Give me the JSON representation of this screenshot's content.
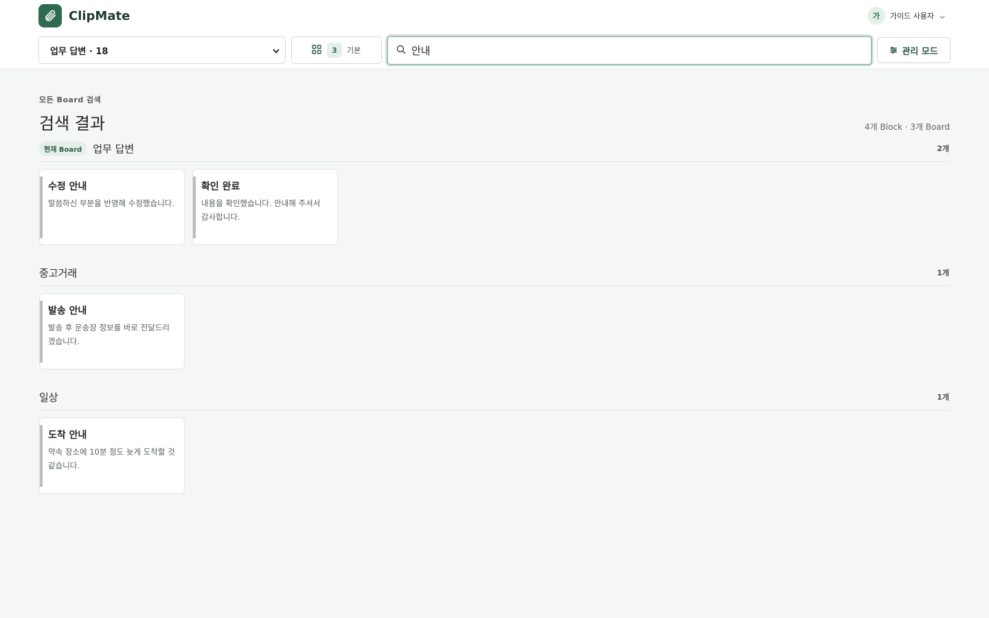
{
  "app": {
    "name": "ClipMate",
    "accent": "#2e6a4f"
  },
  "user": {
    "avatar_initial": "가",
    "name": "가이드 사용자"
  },
  "toolbar": {
    "board_select": {
      "selected": "업무 답변 · 18"
    },
    "view_toggle": {
      "count": "3",
      "label": "기본"
    },
    "search": {
      "value": "안내",
      "placeholder": ""
    },
    "admin_label": "관리 모드"
  },
  "results": {
    "eyebrow": "모든 Board 검색",
    "title": "검색 결과",
    "summary": "4개 Block · 3개 Board",
    "groups": [
      {
        "badge": "현재 Board",
        "name": "업무 답변",
        "count": "2개",
        "cards": [
          {
            "title": "수정 안내",
            "body": "말씀하신 부분을 반영해 수정했습니다."
          },
          {
            "title": "확인 완료",
            "body": "내용을 확인했습니다. 안내해 주셔서 감사합니다."
          }
        ]
      },
      {
        "name": "중고거래",
        "count": "1개",
        "cards": [
          {
            "title": "발송 안내",
            "body": "발송 후 운송장 정보를 바로 전달드리겠습니다."
          }
        ]
      },
      {
        "name": "일상",
        "count": "1개",
        "cards": [
          {
            "title": "도착 안내",
            "body": "약속 장소에 10분 정도 늦게 도착할 것 같습니다."
          }
        ]
      }
    ]
  }
}
